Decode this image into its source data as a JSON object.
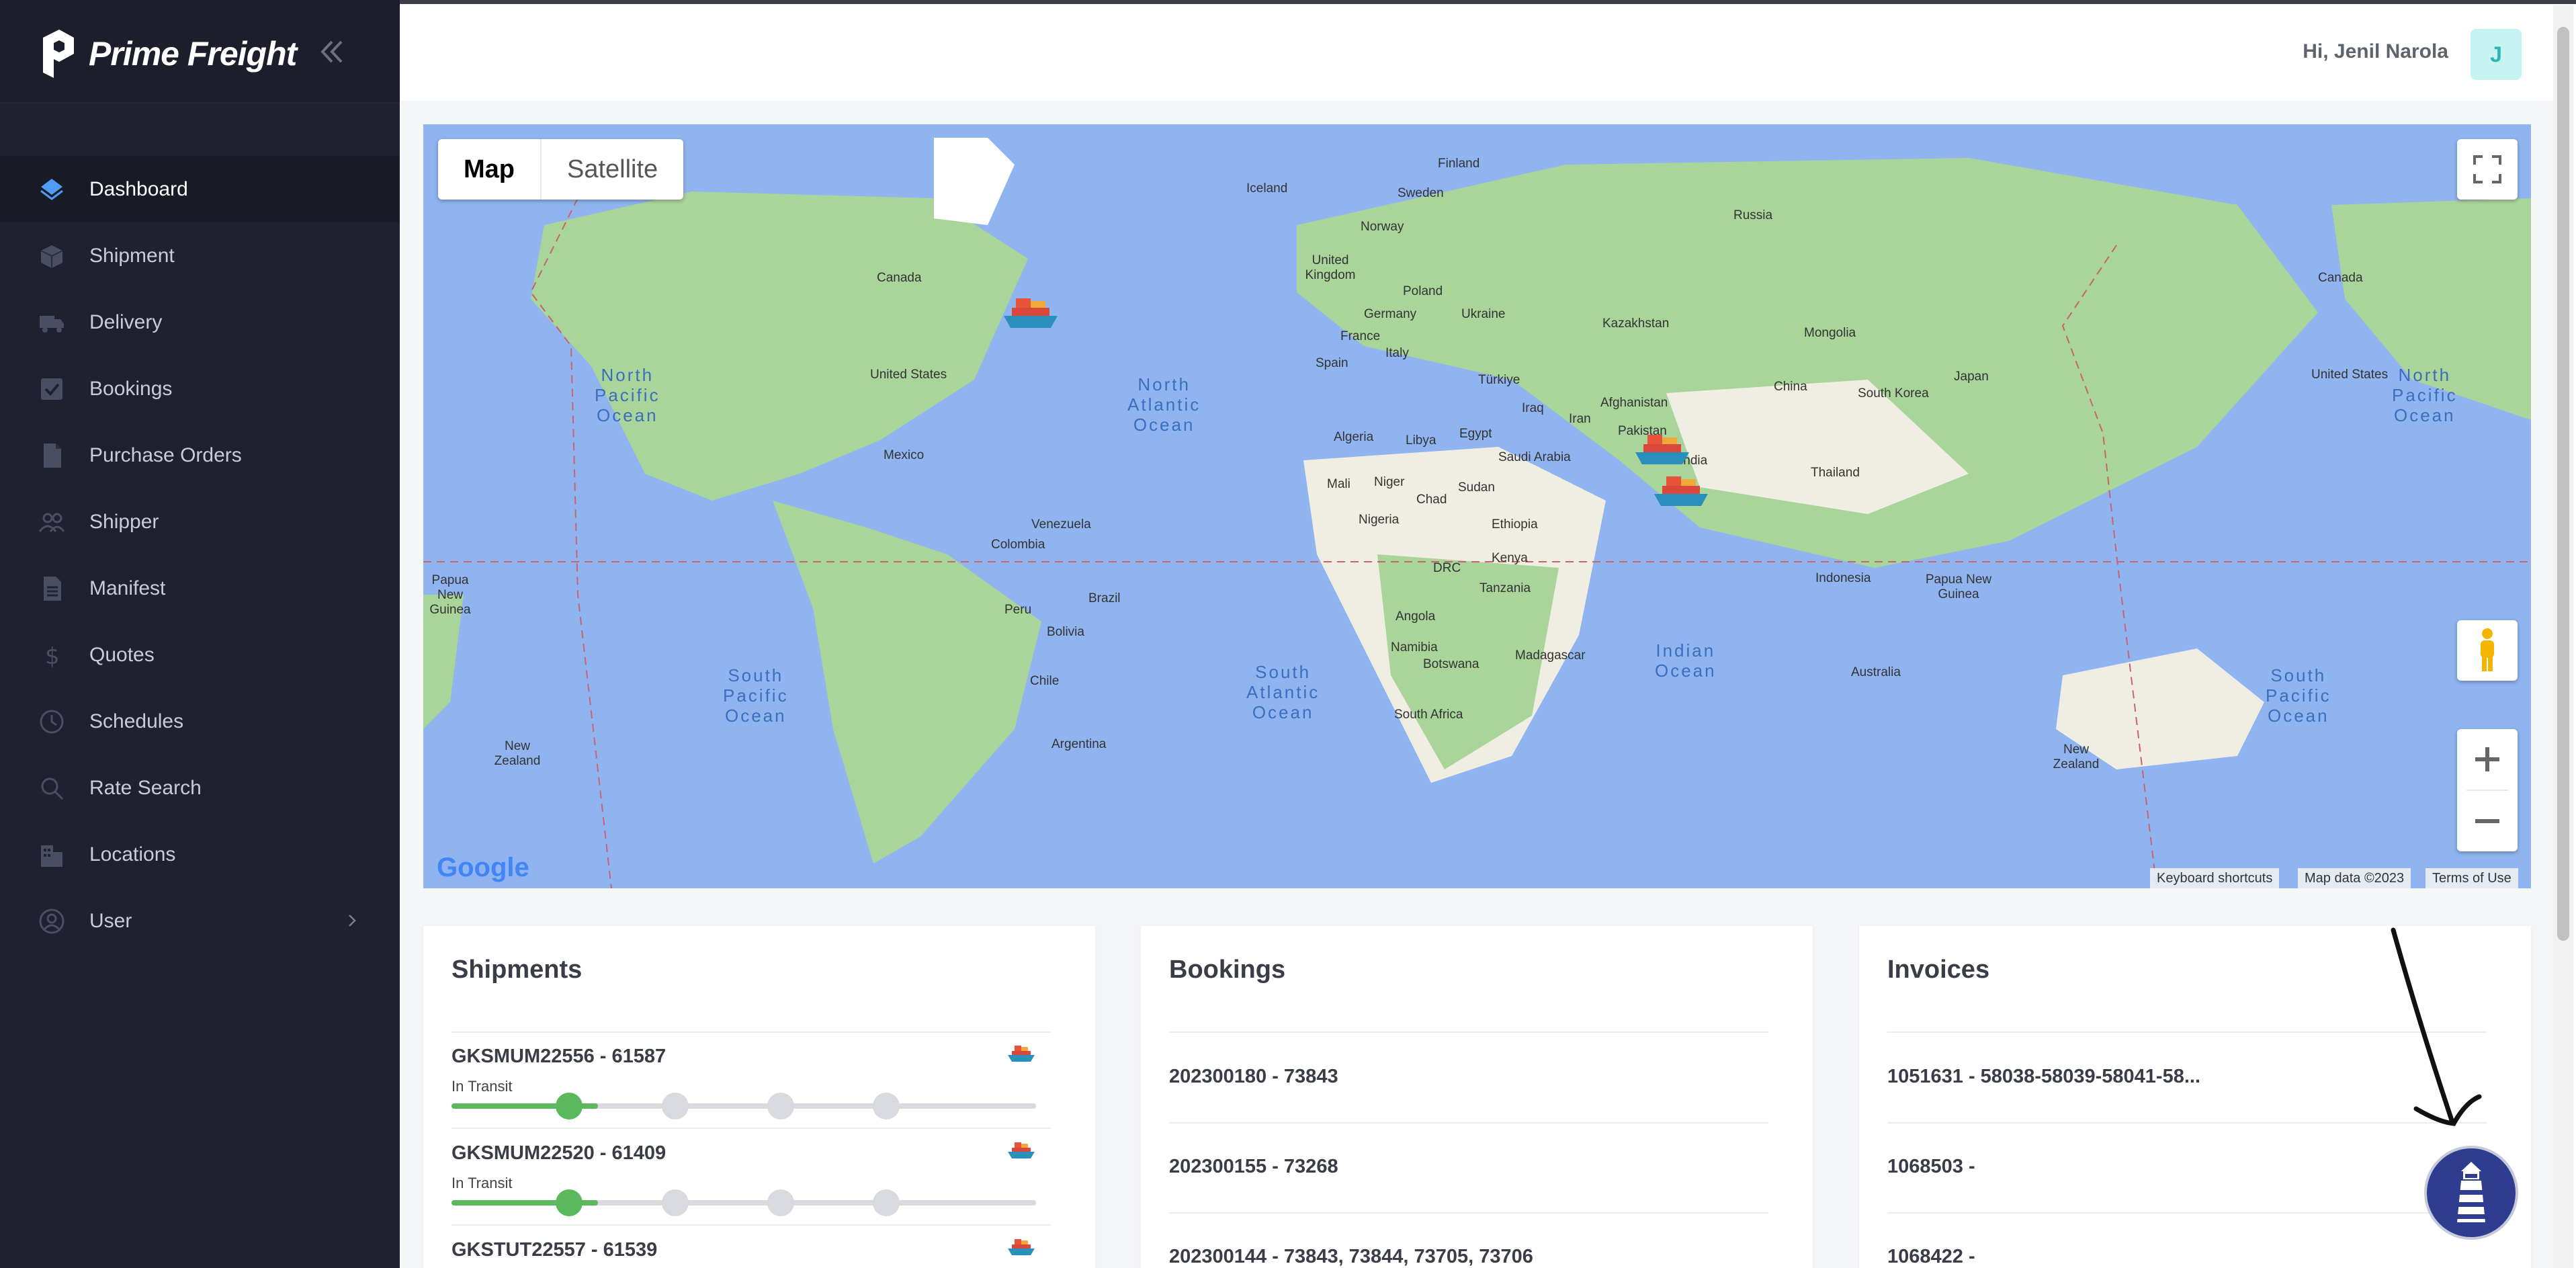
{
  "app": {
    "name": "Prime Freight"
  },
  "header": {
    "greeting": "Hi, Jenil Narola",
    "avatar_initial": "J"
  },
  "sidebar": {
    "items": [
      {
        "label": "Dashboard",
        "icon": "dashboard-icon",
        "active": true
      },
      {
        "label": "Shipment",
        "icon": "box-icon"
      },
      {
        "label": "Delivery",
        "icon": "truck-icon"
      },
      {
        "label": "Bookings",
        "icon": "checkbox-icon"
      },
      {
        "label": "Purchase Orders",
        "icon": "document-icon"
      },
      {
        "label": "Shipper",
        "icon": "users-icon"
      },
      {
        "label": "Manifest",
        "icon": "file-text-icon"
      },
      {
        "label": "Quotes",
        "icon": "dollar-icon"
      },
      {
        "label": "Schedules",
        "icon": "clock-icon"
      },
      {
        "label": "Rate Search",
        "icon": "search-icon"
      },
      {
        "label": "Locations",
        "icon": "buildings-icon"
      },
      {
        "label": "User",
        "icon": "user-circle-icon",
        "has_submenu": true
      }
    ]
  },
  "map": {
    "type_buttons": {
      "map": "Map",
      "satellite": "Satellite"
    },
    "attribution": {
      "shortcuts": "Keyboard shortcuts",
      "data": "Map data ©2023",
      "terms": "Terms of Use"
    },
    "logo": "Google",
    "countries": [
      "Finland",
      "Sweden",
      "Norway",
      "Iceland",
      "Russia",
      "United Kingdom",
      "Poland",
      "Germany",
      "Ukraine",
      "France",
      "Italy",
      "Spain",
      "Kazakhstan",
      "Mongolia",
      "Türkiye",
      "Iraq",
      "Iran",
      "Afghanistan",
      "Pakistan",
      "India",
      "China",
      "South Korea",
      "Japan",
      "Thailand",
      "Canada",
      "United States",
      "Mexico",
      "Algeria",
      "Libya",
      "Egypt",
      "Saudi Arabia",
      "Mali",
      "Niger",
      "Chad",
      "Sudan",
      "Nigeria",
      "Ethiopia",
      "Venezuela",
      "Colombia",
      "Brazil",
      "Peru",
      "Bolivia",
      "Chile",
      "Argentina",
      "DRC",
      "Kenya",
      "Tanzania",
      "Angola",
      "Namibia",
      "Botswana",
      "Madagascar",
      "South Africa",
      "Indonesia",
      "Papua New Guinea",
      "Australia",
      "New Zealand",
      "Canada",
      "United States",
      "New Zealand",
      "Papua New Guinea"
    ],
    "oceans": [
      "North\nPacific\nOcean",
      "North\nAtlantic\nOcean",
      "South\nPacific\nOcean",
      "South\nAtlantic\nOcean",
      "Indian\nOcean",
      "North\nPacific\nOcean",
      "South\nPacific\nOcean"
    ]
  },
  "cards": {
    "shipments": {
      "title": "Shipments",
      "rows": [
        {
          "id": "GKSMUM22556 - 61587",
          "status": "In Transit",
          "progress": 0.25,
          "step": 1
        },
        {
          "id": "GKSMUM22520 - 61409",
          "status": "In Transit",
          "progress": 0.25,
          "step": 1
        },
        {
          "id": "GKSTUT22557 - 61539",
          "status": "",
          "progress": 0,
          "step": 0
        }
      ]
    },
    "bookings": {
      "title": "Bookings",
      "rows": [
        "202300180 - 73843",
        "202300155 - 73268",
        "202300144 - 73843, 73844, 73705, 73706"
      ]
    },
    "invoices": {
      "title": "Invoices",
      "rows": [
        "1051631 - 58038-58039-58041-58...",
        "1068503 -",
        "1068422 -"
      ]
    }
  }
}
